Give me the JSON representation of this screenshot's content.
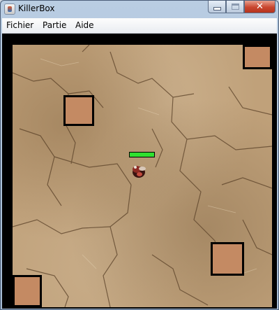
{
  "window": {
    "title": "KillerBox",
    "close_symbol": "✕"
  },
  "menu": {
    "items": [
      "Fichier",
      "Partie",
      "Aide"
    ]
  },
  "game": {
    "player": {
      "health_fraction": 1.0
    },
    "colors": {
      "block_fill": "#c48a63",
      "health": "#2fe02f",
      "border": "#000000"
    }
  }
}
